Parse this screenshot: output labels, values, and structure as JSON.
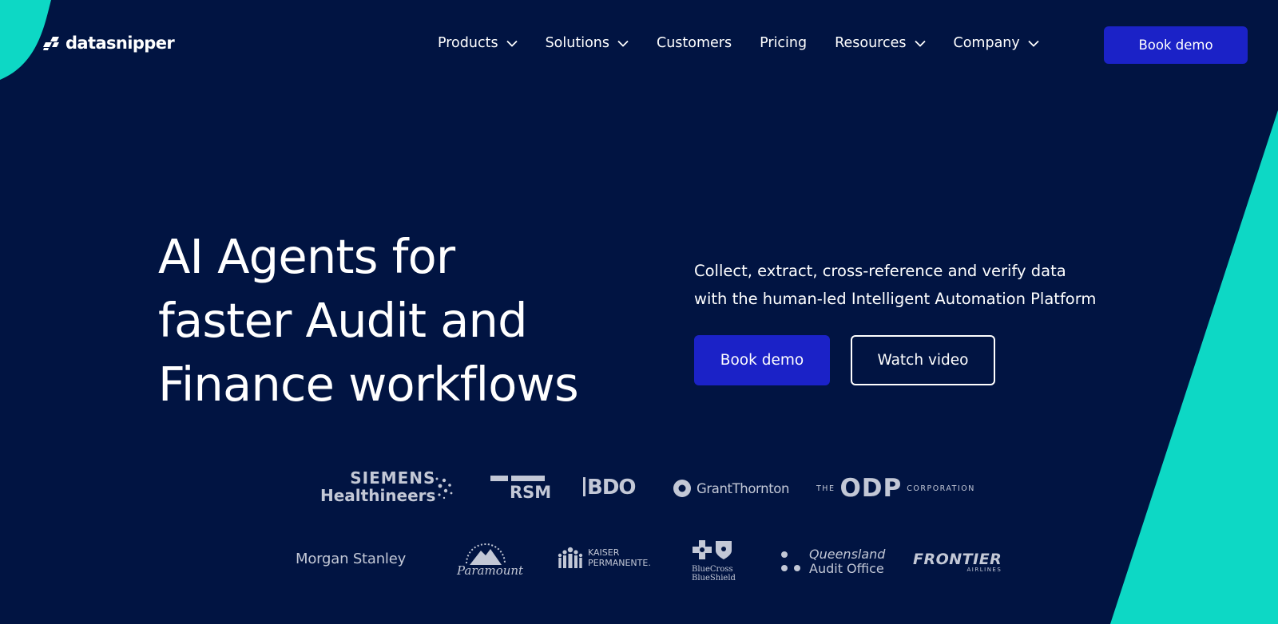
{
  "brand": {
    "name": "datasnipper",
    "colors": {
      "background": "#011442",
      "accent": "#1b22c7",
      "teal": "#0dd8c5",
      "logo_gray": "#c3c8d6"
    }
  },
  "nav": {
    "items": [
      {
        "label": "Products",
        "has_dropdown": true
      },
      {
        "label": "Solutions",
        "has_dropdown": true
      },
      {
        "label": "Customers",
        "has_dropdown": false
      },
      {
        "label": "Pricing",
        "has_dropdown": false
      },
      {
        "label": "Resources",
        "has_dropdown": true
      },
      {
        "label": "Company",
        "has_dropdown": true
      }
    ],
    "cta_label": "Book demo"
  },
  "hero": {
    "title_lines": [
      "AI Agents for",
      "faster Audit and",
      "Finance workflows"
    ],
    "subtitle_lines": [
      "Collect, extract, cross-reference and verify data",
      "with the human-led Intelligent Automation Platform"
    ],
    "primary_cta": "Book demo",
    "secondary_cta": "Watch video"
  },
  "customer_logos": {
    "row1": {
      "siemens_line1": "SIEMENS",
      "siemens_line2": "Healthineers",
      "rsm": "RSM",
      "bdo": "BDO",
      "grant_thornton": "GrantThornton",
      "odp_the": "THE",
      "odp_main": "ODP",
      "odp_corp": "CORPORATION"
    },
    "row2": {
      "morgan_stanley": "Morgan Stanley",
      "paramount": "Paramount",
      "kaiser_line1": "KAISER",
      "kaiser_line2": "PERMANENTE.",
      "bcbs_line1": "BlueCross",
      "bcbs_line2": "BlueShield",
      "qao_line1": "Queensland",
      "qao_line2": "Audit Office",
      "frontier": "FRONTIER",
      "frontier_sub": "AIRLINES"
    }
  }
}
